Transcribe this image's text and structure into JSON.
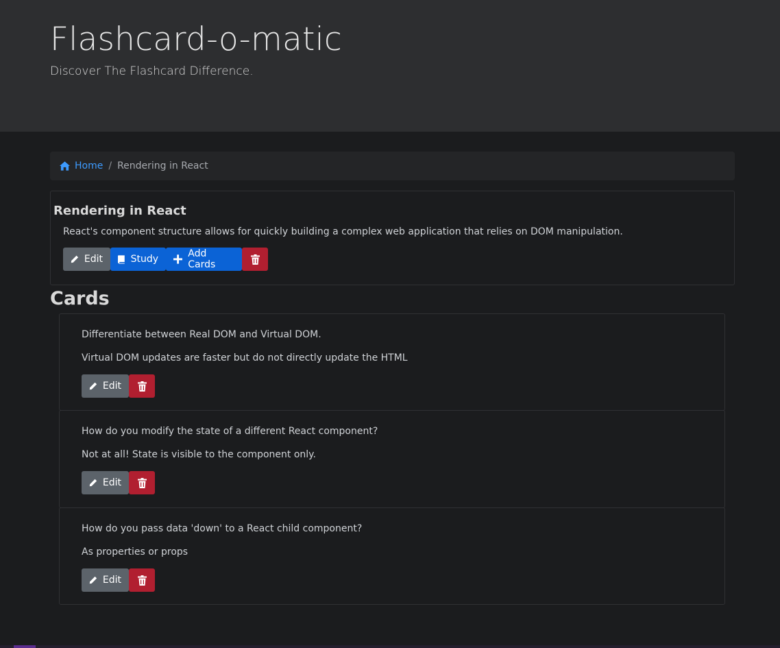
{
  "header": {
    "title": "Flashcard-o-matic",
    "subtitle": "Discover The Flashcard Difference."
  },
  "breadcrumb": {
    "home_label": "Home",
    "separator": "/",
    "current": "Rendering in React"
  },
  "deck": {
    "name": "Rendering in React",
    "description": "React's component structure allows for quickly building a complex web application that relies on DOM manipulation.",
    "buttons": {
      "edit": "Edit",
      "study": "Study",
      "add_cards": "Add Cards",
      "delete_icon": "trash-icon"
    }
  },
  "cards_heading": "Cards",
  "cards": [
    {
      "front": "Differentiate between Real DOM and Virtual DOM.",
      "back": "Virtual DOM updates are faster but do not directly update the HTML",
      "edit_label": "Edit"
    },
    {
      "front": "How do you modify the state of a different React component?",
      "back": "Not at all! State is visible to the component only.",
      "edit_label": "Edit"
    },
    {
      "front": "How do you pass data 'down' to a React child component?",
      "back": "As properties or props",
      "edit_label": "Edit"
    }
  ],
  "colors": {
    "background": "#1b1c1e",
    "header_bg": "#2d2e30",
    "link": "#3d9bff",
    "secondary": "#5c636a",
    "primary": "#0b63d6",
    "danger": "#b11f30"
  },
  "icons": {
    "home": "house-icon",
    "edit": "pencil-icon",
    "study": "book-icon",
    "add": "plus-icon",
    "delete": "trash-icon"
  }
}
